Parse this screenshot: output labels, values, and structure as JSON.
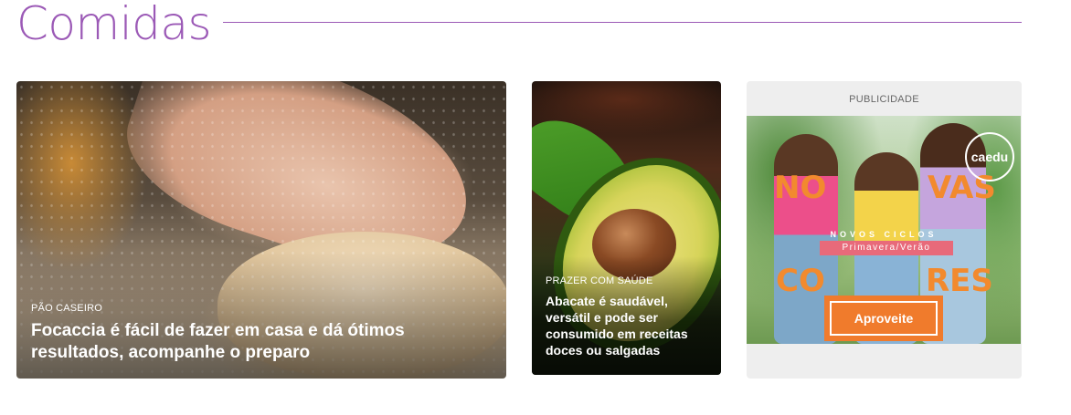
{
  "section": {
    "title": "Comidas"
  },
  "cards": [
    {
      "kicker": "PÃO CASEIRO",
      "headline": "Focaccia é fácil de fazer em casa e dá ótimos resultados, acompanhe o preparo"
    },
    {
      "kicker": "PRAZER COM SAÚDE",
      "headline": "Abacate é saudável, versátil e pode ser consumido em receitas doces ou salgadas"
    }
  ],
  "ad": {
    "label": "PUBLICIDADE",
    "brand": "caedu",
    "tagline": "NOVOS CICLOS",
    "subtag": "Primavera/Verão",
    "cta": "Aproveite",
    "letters": [
      "NO",
      "VAS",
      "CO",
      "RES"
    ],
    "accent_color": "#f07b2c"
  },
  "colors": {
    "section_purple": "#9b59b6"
  }
}
